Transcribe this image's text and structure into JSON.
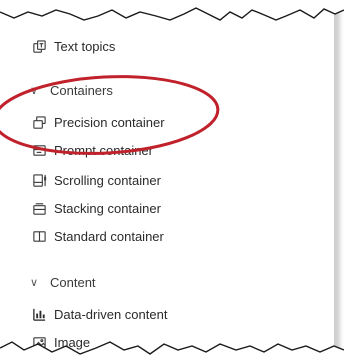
{
  "items": {
    "text_topics": "Text topics",
    "containers": "Containers",
    "precision_container": "Precision container",
    "prompt_container": "Prompt container",
    "scrolling_container": "Scrolling container",
    "stacking_container": "Stacking container",
    "standard_container": "Standard container",
    "content": "Content",
    "data_driven_content": "Data-driven content",
    "image": "Image"
  },
  "icons": {
    "text_topics": "text-topics-icon",
    "precision_container": "precision-container-icon",
    "prompt_container": "prompt-container-icon",
    "scrolling_container": "scrolling-container-icon",
    "stacking_container": "stacking-container-icon",
    "standard_container": "standard-container-icon",
    "data_driven_content": "bar-chart-icon",
    "image": "image-icon",
    "chevron": "chevron-down-icon"
  },
  "colors": {
    "highlight_ellipse": "#c0212b",
    "text": "#2b2b2b",
    "icon": "#3a3a3a"
  }
}
